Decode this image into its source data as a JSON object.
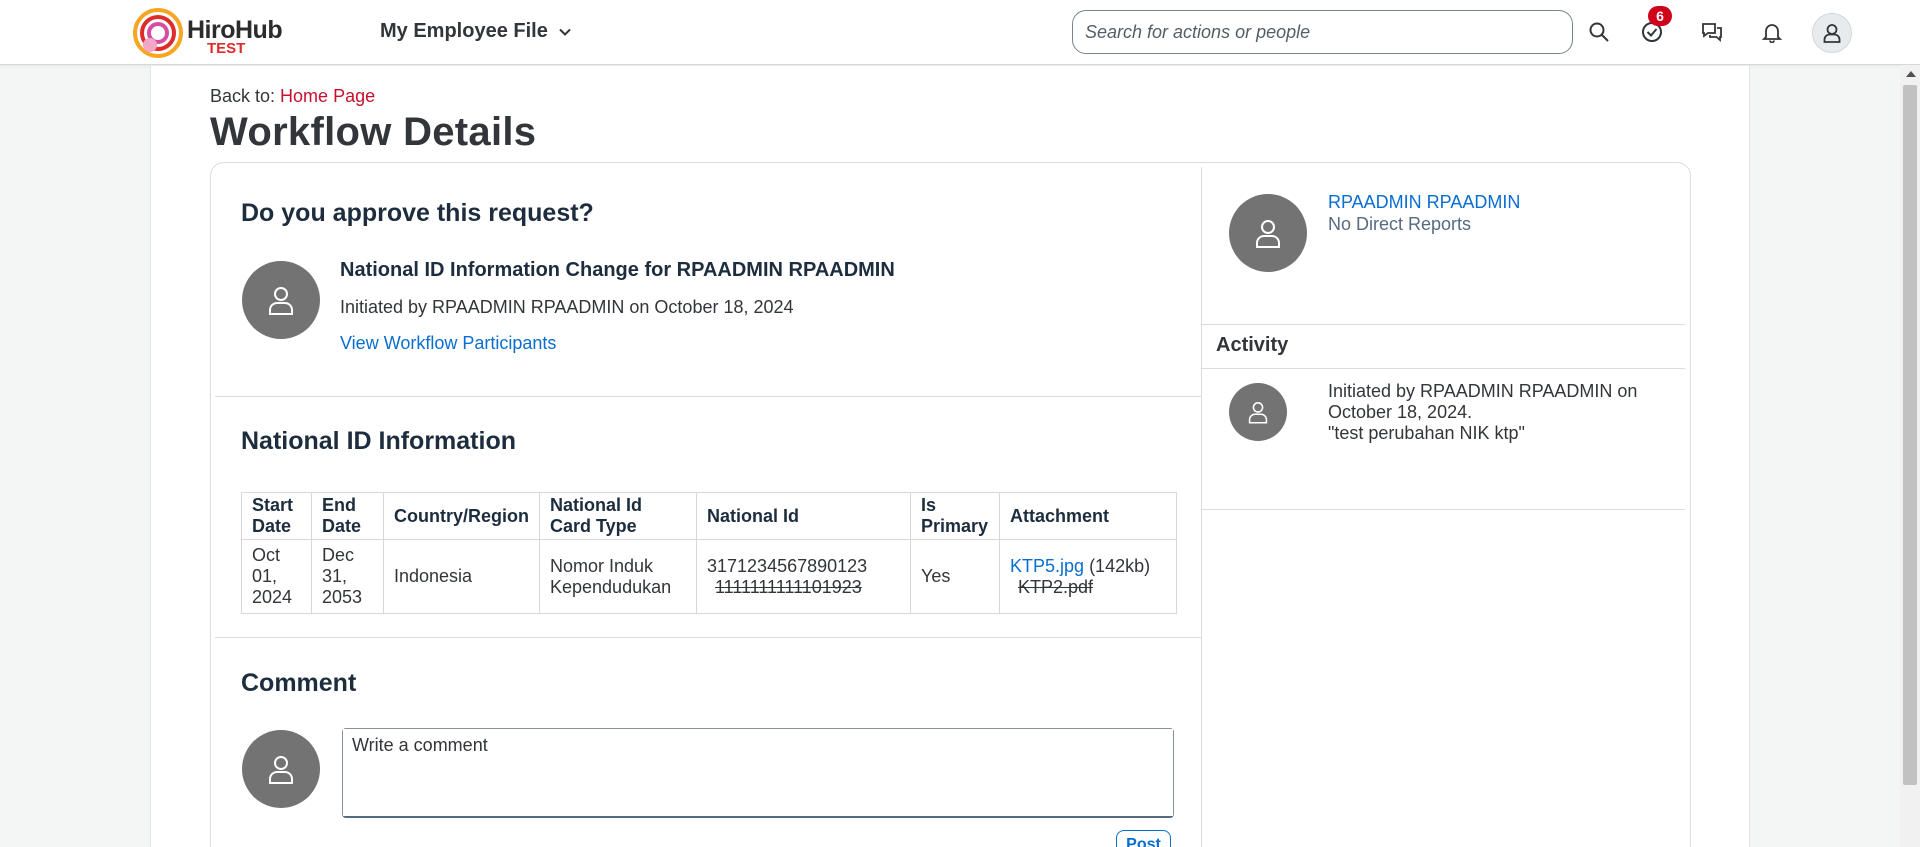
{
  "brand": {
    "name": "HiroHub",
    "env": "TEST"
  },
  "header": {
    "nav_title": "My Employee File",
    "search_placeholder": "Search for actions or people",
    "todo_badge": "6"
  },
  "page": {
    "back_prefix": "Back to:",
    "back_link": "Home Page",
    "title": "Workflow Details"
  },
  "request": {
    "question": "Do you approve this request?",
    "title": "National ID Information Change for RPAADMIN RPAADMIN",
    "initiated": "Initiated by RPAADMIN RPAADMIN on October 18, 2024",
    "participants_link": "View Workflow Participants"
  },
  "national_id": {
    "heading": "National ID Information",
    "columns": [
      "Start Date",
      "End Date",
      "Country/Region",
      "National Id Card Type",
      "National Id",
      "Is Primary",
      "Attachment"
    ],
    "row": {
      "start_date": "Oct 01, 2024",
      "end_date": "Dec 31, 2053",
      "country": "Indonesia",
      "card_type": "Nomor Induk Kependudukan",
      "national_id_new": "3171234567890123",
      "national_id_old": "1111111111101923",
      "is_primary": "Yes",
      "attachment_new": "KTP5.jpg",
      "attachment_size": "(142kb)",
      "attachment_old": "KTP2.pdf"
    }
  },
  "comment": {
    "heading": "Comment",
    "placeholder": "Write a comment",
    "post_label": "Post"
  },
  "side": {
    "name": "RPAADMIN RPAADMIN",
    "reports": "No Direct Reports",
    "activity_title": "Activity",
    "activity_line1": "Initiated by RPAADMIN RPAADMIN on October 18, 2024.",
    "activity_line2": "\"test perubahan NIK ktp\""
  },
  "colors": {
    "link": "#0a6ed1",
    "brand_red": "#e02b2b",
    "badge": "#d0021b",
    "avatar_grey": "#737373"
  }
}
